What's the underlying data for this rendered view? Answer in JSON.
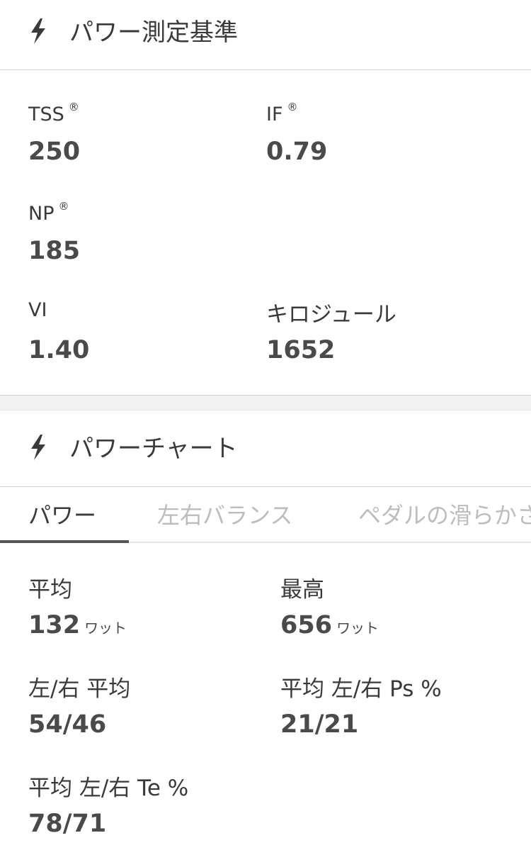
{
  "power_metrics": {
    "title": "パワー測定基準",
    "tss": {
      "label": "TSS",
      "mark": "®",
      "value": "250"
    },
    "if": {
      "label": "IF",
      "mark": "®",
      "value": "0.79"
    },
    "np": {
      "label": "NP",
      "mark": "®",
      "value": "185"
    },
    "vi": {
      "label": "VI",
      "value": "1.40"
    },
    "kilojoules": {
      "label": "キロジュール",
      "value": "1652"
    }
  },
  "power_chart": {
    "title": "パワーチャート",
    "tabs": [
      {
        "label": "パワー",
        "active": true
      },
      {
        "label": "左右バランス",
        "active": false
      },
      {
        "label": "ペダルの滑らかさ",
        "active": false
      }
    ],
    "stats": {
      "avg": {
        "label": "平均",
        "value": "132",
        "unit": "ワット"
      },
      "max": {
        "label": "最高",
        "value": "656",
        "unit": "ワット"
      },
      "lr_avg": {
        "label": "左/右 平均",
        "value": "54/46"
      },
      "avg_lr_ps": {
        "label": "平均 左/右 Ps %",
        "value": "21/21"
      },
      "avg_lr_te": {
        "label": "平均 左/右 Te %",
        "value": "78/71"
      }
    }
  },
  "colors": {
    "text": "#3a3a3a",
    "value": "#4a4a4a",
    "inactive_tab": "#bdbdbd",
    "divider": "#cfcfcf"
  },
  "icons": {
    "section": "lightning-bolt-icon"
  }
}
